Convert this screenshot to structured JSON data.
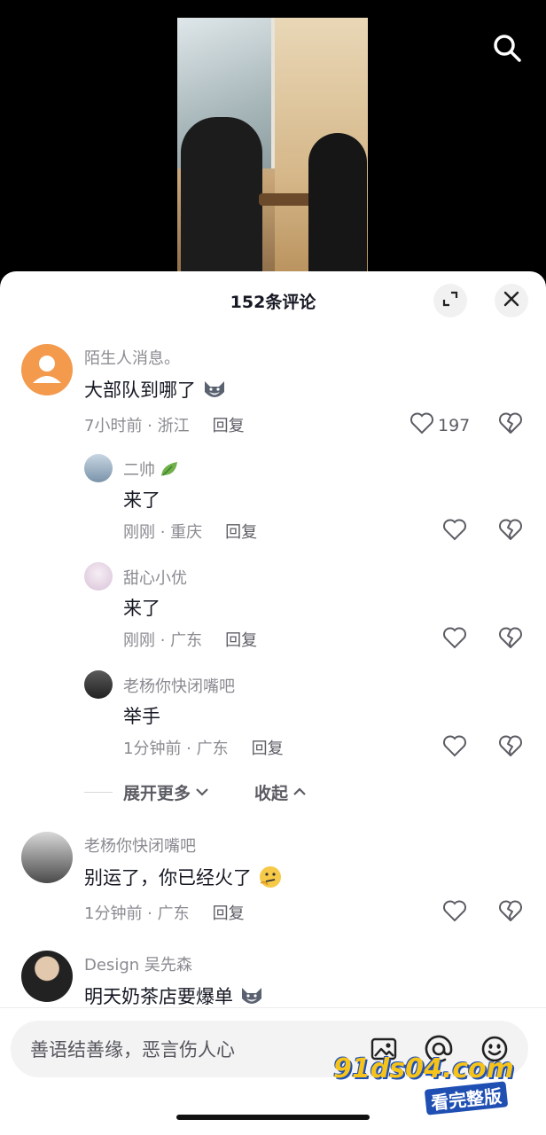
{
  "sheet": {
    "title": "152条评论"
  },
  "comments": [
    {
      "user": "陌生人消息。",
      "text": "大部队到哪了",
      "emoji": "wolf-emoji",
      "meta": "7小时前 · 浙江",
      "reply_label": "回复",
      "likes": "197",
      "avatar": {
        "type": "default",
        "color": "#f39a4d"
      }
    },
    {
      "user": "二帅",
      "user_badge": "leaf-icon",
      "text": "来了",
      "meta": "刚刚 · 重庆",
      "reply_label": "回复",
      "likes": "",
      "avatar": {
        "type": "photo",
        "color": "#9fb4c8"
      }
    },
    {
      "user": "甜心小优",
      "text": "来了",
      "meta": "刚刚 · 广东",
      "reply_label": "回复",
      "likes": "",
      "avatar": {
        "type": "photo",
        "color": "#e9dbe8"
      }
    },
    {
      "user": "老杨你快闭嘴吧",
      "text": "举手",
      "meta": "1分钟前 · 广东",
      "reply_label": "回复",
      "likes": "",
      "avatar": {
        "type": "photo",
        "color": "#3a3a3a"
      }
    },
    {
      "user": "老杨你快闭嘴吧",
      "text": "别运了，你已经火了",
      "emoji": "thinking-emoji",
      "meta": "1分钟前 · 广东",
      "reply_label": "回复",
      "likes": "",
      "avatar": {
        "type": "photo",
        "color": "#4a4a4a"
      }
    },
    {
      "user": "Design 吴先森",
      "text": "明天奶茶店要爆单",
      "emoji": "wolf-emoji",
      "meta": "",
      "reply_label": "",
      "likes": "",
      "avatar": {
        "type": "photo",
        "color": "#222222"
      }
    }
  ],
  "thread_controls": {
    "expand_more": "展开更多",
    "collapse": "收起"
  },
  "input": {
    "placeholder": "善语结善缘，恶言伤人心"
  },
  "watermark": {
    "top": "91ds04.com",
    "bottom": "看完整版"
  },
  "colors": {
    "accent_text": "#161823",
    "meta_text": "#8a8b91",
    "sheet_bg": "#ffffff"
  }
}
